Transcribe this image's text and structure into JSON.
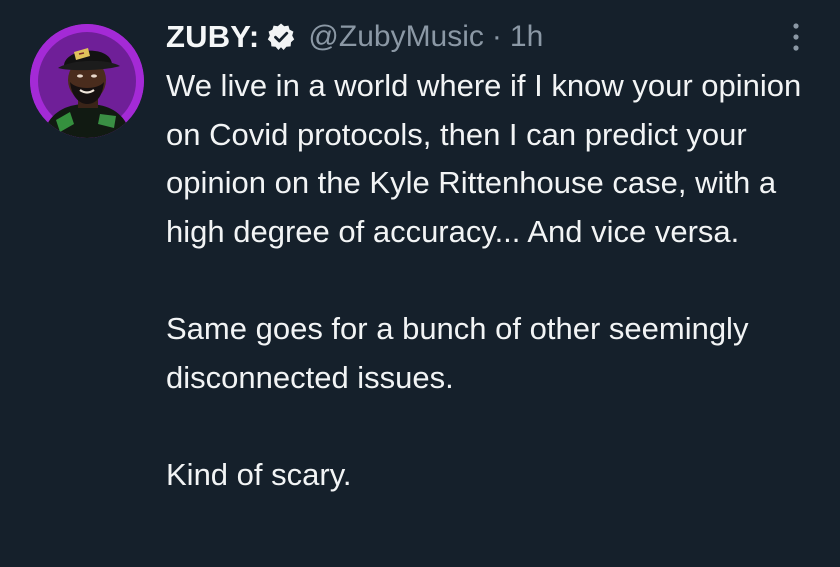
{
  "tweet": {
    "display_name": "ZUBY:",
    "handle": "@ZubyMusic",
    "separator": "·",
    "timestamp": "1h",
    "verified_icon": "verified-badge-icon",
    "more_icon": "more-vertical-icon",
    "avatar_icon": "profile-photo",
    "paragraphs": [
      "We live in a world where if I know your opinion on Covid protocols, then I can predict your opinion on the Kyle Rittenhouse case, with a high degree of accuracy... And vice versa.",
      "Same goes for a bunch of other seemingly disconnected issues.",
      "Kind of scary."
    ]
  },
  "colors": {
    "background": "#15202b",
    "text": "#f2f4f5",
    "secondary_text": "#8b98a5",
    "avatar_ring": "#a42ad6"
  }
}
